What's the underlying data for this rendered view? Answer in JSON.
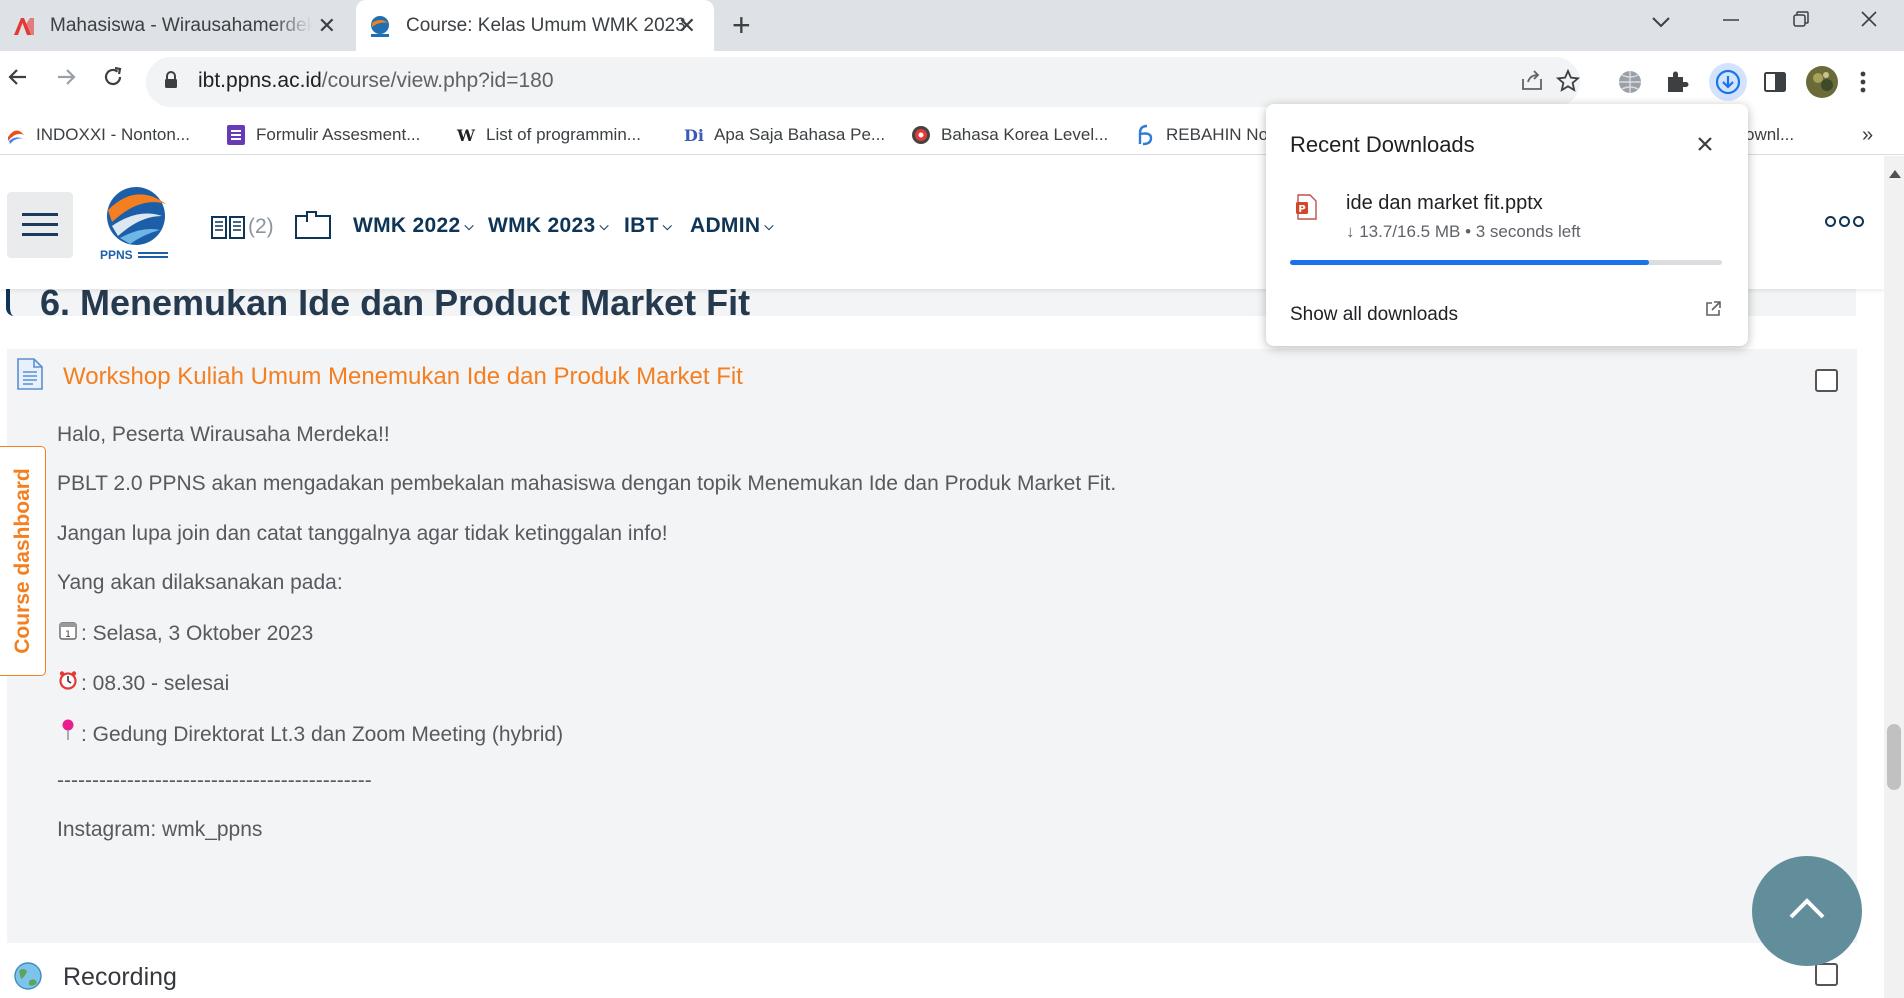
{
  "browser": {
    "tabs": [
      {
        "title": "Mahasiswa - Wirausahamerdeka",
        "active": false,
        "icon": "red-a-icon"
      },
      {
        "title": "Course: Kelas Umum WMK 2023",
        "active": true,
        "icon": "ppns-logo-icon"
      }
    ],
    "close_glyph": "✕",
    "new_tab_glyph": "+",
    "url_host": "ibt.ppns.ac.id",
    "url_path": "/course/view.php?id=180",
    "bookmarks": [
      {
        "label": "INDOXXI - Nonton...",
        "icon": "indoxxi-icon"
      },
      {
        "label": "Formulir Assesment...",
        "icon": "forms-icon"
      },
      {
        "label": "List of programmin...",
        "icon": "wikipedia-icon"
      },
      {
        "label": "Apa Saja Bahasa Pe...",
        "icon": "di-icon"
      },
      {
        "label": "Bahasa Korea Level...",
        "icon": "korea-icon"
      },
      {
        "label": "REBAHIN No",
        "icon": "rebahin-icon"
      },
      {
        "label": "ownl...",
        "icon": ""
      }
    ],
    "bookmarks_overflow": "»"
  },
  "downloads": {
    "title": "Recent Downloads",
    "file_name": "ide dan market fit.pptx",
    "status": "↓ 13.7/16.5 MB • 3 seconds left",
    "progress": 0.83,
    "show_all": "Show all downloads",
    "accent": "#1a73e8"
  },
  "site": {
    "logo_text": "PPNS",
    "books_count": "(2)",
    "menu": [
      {
        "label": "WMK 2022"
      },
      {
        "label": "WMK 2023"
      },
      {
        "label": "IBT"
      },
      {
        "label": "ADMIN"
      }
    ],
    "caret": "⌵"
  },
  "course": {
    "section_title_partial": "6. Menemukan Ide dan Product Market Fit",
    "activity_title": "Workshop Kuliah Umum Menemukan Ide dan Produk Market Fit",
    "description": [
      {
        "emoji": "",
        "text": "Halo, Peserta Wirausaha Merdeka!!"
      },
      {
        "emoji": "",
        "text": "PBLT 2.0 PPNS akan mengadakan pembekalan mahasiswa dengan topik Menemukan Ide dan Produk Market Fit."
      },
      {
        "emoji": "",
        "text": "Jangan lupa join dan catat tanggalnya agar tidak ketinggalan info!"
      },
      {
        "emoji": "",
        "text": "Yang akan dilaksanakan pada:"
      },
      {
        "emoji": "🗓",
        "text": ": Selasa, 3 Oktober 2023"
      },
      {
        "emoji": "⏰",
        "text": ": 08.30 - selesai"
      },
      {
        "emoji": "📍",
        "text": ": Gedung Direktorat Lt.3 dan Zoom Meeting (hybrid)"
      },
      {
        "emoji": "",
        "text": "---------------------------------------------"
      },
      {
        "emoji": "",
        "text": "Instagram: wmk_ppns"
      }
    ],
    "next_activity": "Recording",
    "dashboard_tab": "Course dashboard",
    "accent_orange": "#f47f20",
    "nav_blue": "#0f3556"
  }
}
